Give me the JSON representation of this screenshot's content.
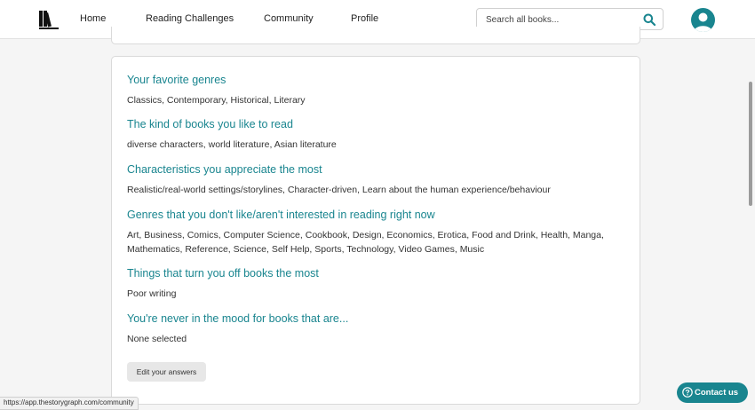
{
  "nav": {
    "logo": "storygraph-logo",
    "links": [
      "Home",
      "Reading Challenges",
      "Community",
      "Profile"
    ],
    "active": "Community",
    "search_placeholder": "Search all books...",
    "accent_color": "#19858f"
  },
  "preferences": {
    "sections": [
      {
        "title": "Your favorite genres",
        "text": "Classics, Contemporary, Historical, Literary"
      },
      {
        "title": "The kind of books you like to read",
        "text": "diverse characters, world literature, Asian literature"
      },
      {
        "title": "Characteristics you appreciate the most",
        "text": "Realistic/real-world settings/storylines, Character-driven, Learn about the human experience/behaviour"
      },
      {
        "title": "Genres that you don't like/aren't interested in reading right now",
        "text": "Art, Business, Comics, Computer Science, Cookbook, Design, Economics, Erotica, Food and Drink, Health, Manga, Mathematics, Reference, Science, Self Help, Sports, Technology, Video Games, Music"
      },
      {
        "title": "Things that turn you off books the most",
        "text": "Poor writing"
      },
      {
        "title": "You're never in the mood for books that are...",
        "text": "None selected"
      }
    ],
    "edit_button": "Edit your answers"
  },
  "status_url": "https://app.thestorygraph.com/community",
  "contact_button": "Contact us"
}
